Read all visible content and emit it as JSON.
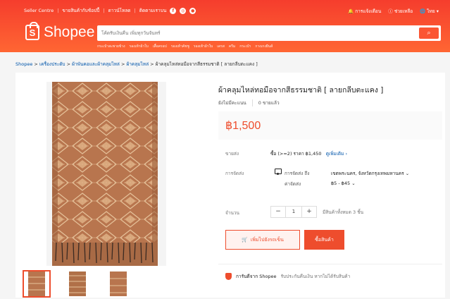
{
  "topbar": {
    "links": [
      "Seller Centre",
      "ขายสินค้ากับช้อปปี้",
      "ดาวน์โหลด",
      "ติดตามเราบน"
    ],
    "social_icons": [
      "f",
      "◎",
      "●"
    ],
    "notifications": "การแจ้งเตือน",
    "help": "ช่วยเหลือ",
    "language": "ไทย"
  },
  "logo": {
    "brand": "Shopee",
    "mark": "S"
  },
  "search": {
    "placeholder": "โค้ดรับเงินคืน เพิ่มทุกวันจันทร์",
    "hints": [
      "กระเป๋าสะพายข้าง",
      "รองเท้าผ้าใบ",
      "เสื้อครอป",
      "รองเท้าคัชชู",
      "รองเท้าผ้าใบ",
      "เดรส",
      "ครีม",
      "กระเป๋า",
      "กางเกงยีนส์"
    ]
  },
  "breadcrumb": {
    "items": [
      "Shopee",
      "เครื่องประดับ",
      "ผ้าพันคอและผ้าคลุมไหล่",
      "ผ้าคลุมไหล่"
    ],
    "current": "ผ้าคลุมไหล่ทอมือจากสีธรรมชาติ [ ลายกลีบตะแคง ]"
  },
  "product": {
    "title": "ผ้าคลุมไหล่ทอมือจากสีธรรมชาติ [ ลายกลีบตะแคง ]",
    "rating_text": "ยังไม่มีคะแนน",
    "sold_count": "0",
    "sold_label": "ขายแล้ว",
    "price": "฿1,500",
    "deal_label": "ขายส่ง",
    "deal_text": "ซื้อ (>=2) ราคา ฿1,450",
    "deal_link": "ดูเพิ่มเติม",
    "shipping_label": "การจัดส่ง",
    "shipping_to": "การจัดส่ง ถึง",
    "shipping_fee_label": "ค่าจัดส่ง",
    "shipping_location": "เขตพระนคร, จังหวัดกรุงเทพมหานคร",
    "shipping_fee": "฿5 - ฿45",
    "qty_label": "จำนวน",
    "qty_value": "1",
    "stock_text": "มีสินค้าทั้งหมด 3 ชิ้น",
    "add_to_cart": "เพิ่มไปยังรถเข็น",
    "buy_now": "ซื้อสินค้า",
    "guarantee_title": "การันตีจาก Shopee",
    "guarantee_sub": "รับประกันคืนเงิน หากไม่ได้รับสินค้า"
  },
  "colors": {
    "accent": "#ee4d2d",
    "fabric": "#b8754e"
  }
}
